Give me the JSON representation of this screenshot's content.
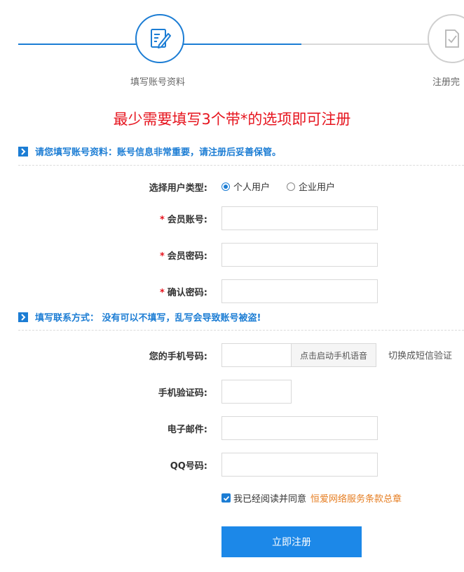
{
  "steps": [
    {
      "label": "填写账号资料",
      "icon": "pen-form-icon",
      "state": "active"
    },
    {
      "label": "注册完",
      "icon": "doc-check-icon",
      "state": "pending"
    }
  ],
  "headline": "最少需要填写3个带*的选项即可注册",
  "section1": {
    "text": "请您填写账号资料：账号信息非常重要，请注册后妥善保管。"
  },
  "section2": {
    "text": "填写联系方式： 没有可以不填写，乱写会导致账号被盗!"
  },
  "fields": {
    "user_type": {
      "label": "选择用户类型:",
      "options": [
        "个人用户",
        "企业用户"
      ],
      "selected": "个人用户"
    },
    "account": {
      "label": "会员账号:",
      "required": true,
      "value": ""
    },
    "password": {
      "label": "会员密码:",
      "required": true,
      "value": ""
    },
    "confirm": {
      "label": "确认密码:",
      "required": true,
      "value": ""
    },
    "phone": {
      "label": "您的手机号码:",
      "value": "",
      "voice_button": "点击启动手机语音",
      "switch_link": "切换成短信验证"
    },
    "code": {
      "label": "手机验证码:",
      "value": ""
    },
    "email": {
      "label": "电子邮件:",
      "value": ""
    },
    "qq": {
      "label": "QQ号码:",
      "value": ""
    }
  },
  "agreement": {
    "checked": true,
    "text": "我已经阅读并同意",
    "link": "恒爱网络服务条款总章"
  },
  "submit_label": "立即注册",
  "colors": {
    "accent": "#1c7dd4",
    "required": "#e6141e",
    "link": "#e67e22"
  }
}
